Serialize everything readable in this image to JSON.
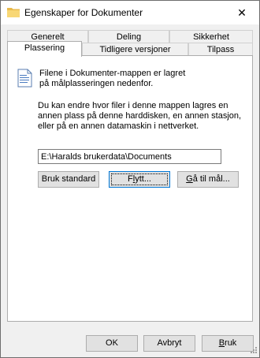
{
  "window": {
    "title": "Egenskaper for Dokumenter",
    "close_symbol": "✕"
  },
  "tabs": {
    "back_row": [
      "Generelt",
      "Deling",
      "Sikkerhet"
    ],
    "front_row": [
      "Plassering",
      "Tidligere versjoner",
      "Tilpass"
    ]
  },
  "content": {
    "description": "Filene i Dokumenter-mappen er lagret på målplasseringen nedenfor.",
    "instructions": "Du kan endre hvor filer i denne mappen lagres en annen plass på denne harddisken, en annen stasjon, eller på en annen datamaskin i nettverket.",
    "path_value": "E:\\Haralds brukerdata\\Documents"
  },
  "buttons": {
    "restore_default": "Bruk standard",
    "move_pre": "F",
    "move_ul": "l",
    "move_post": "ytt...",
    "find_target_ul": "G",
    "find_target_post": "å til mål...",
    "ok": "OK",
    "cancel": "Avbryt",
    "apply_ul": "B",
    "apply_post": "ruk"
  },
  "icons": {
    "app": "folder-icon",
    "close": "close-icon",
    "document": "document-folder-icon",
    "grip": "resize-grip-icon"
  }
}
